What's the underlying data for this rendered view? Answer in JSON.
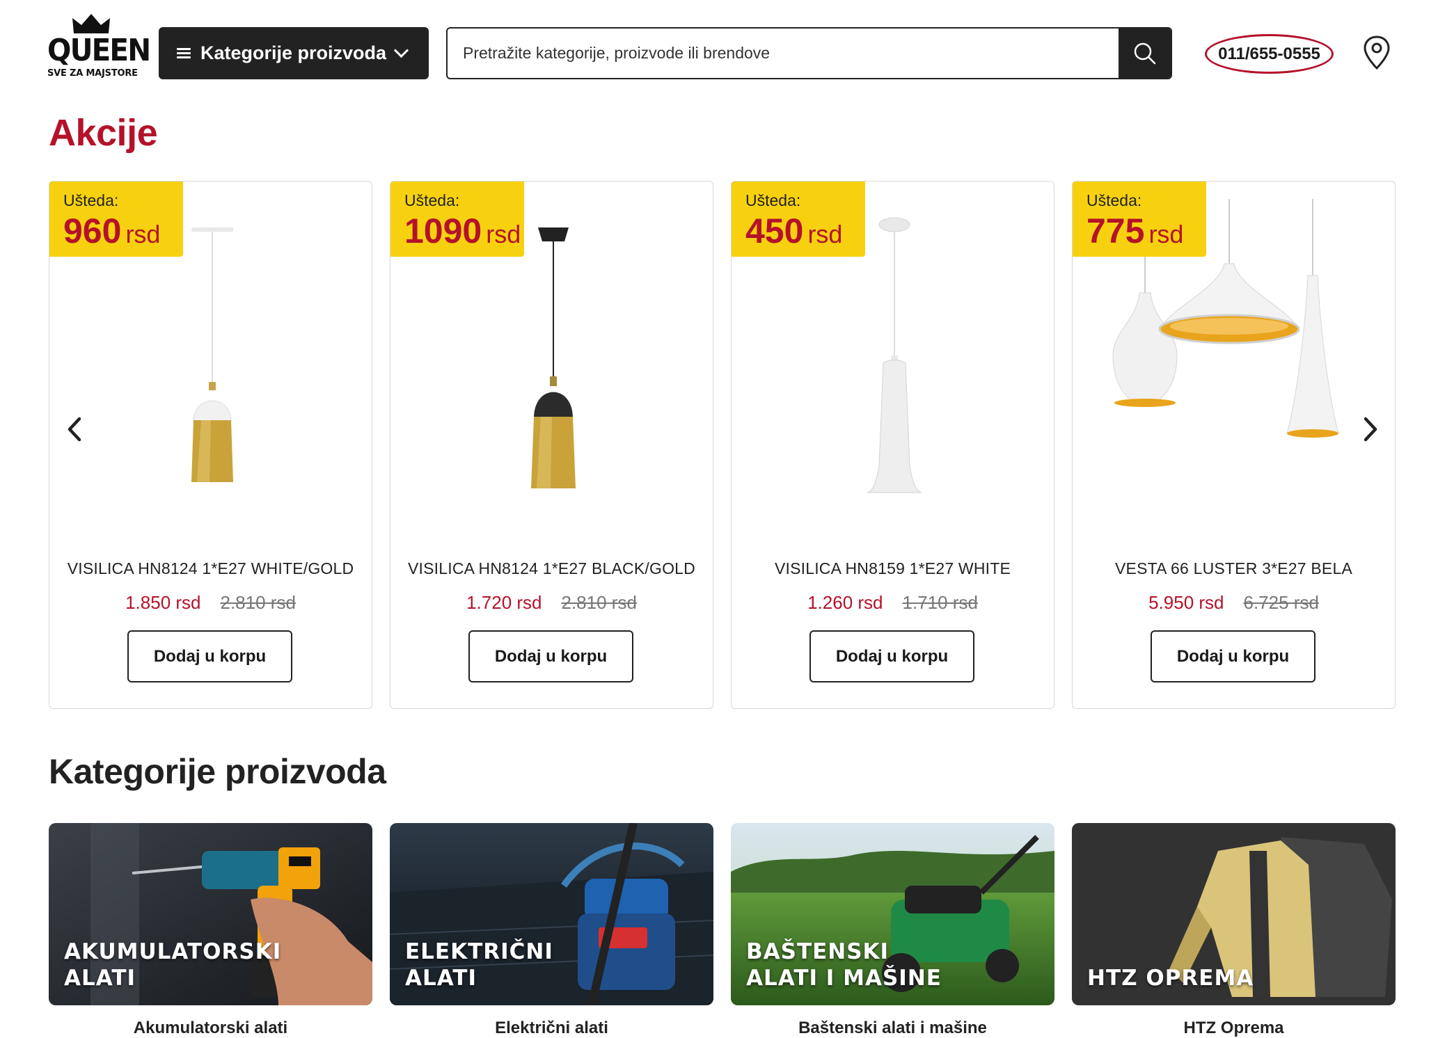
{
  "header": {
    "logo": {
      "brand": "QUEEN",
      "tagline": "SVE ZA MAJSTORE"
    },
    "categories_button": "Kategorije proizvoda",
    "search": {
      "placeholder": "Pretražite kategorije, proizvode ili brendove",
      "value": ""
    },
    "phone": "011/655-0555",
    "icons": {
      "menu": "hamburger-icon",
      "dropdown": "chevron-down-icon",
      "search": "search-icon",
      "location": "location-pin-icon"
    }
  },
  "deals": {
    "title": "Akcije",
    "savings_label": "Ušteda:",
    "currency": "rsd",
    "add_to_cart_label": "Dodaj u korpu",
    "products": [
      {
        "name": "VISILICA HN8124 1*E27 WHITE/GOLD",
        "savings": "960",
        "price": "1.850 rsd",
        "old_price": "2.810 rsd"
      },
      {
        "name": "VISILICA HN8124 1*E27 BLACK/GOLD",
        "savings": "1090",
        "price": "1.720 rsd",
        "old_price": "2.810 rsd"
      },
      {
        "name": "VISILICA HN8159 1*E27 WHITE",
        "savings": "450",
        "price": "1.260 rsd",
        "old_price": "1.710 rsd"
      },
      {
        "name": "VESTA 66 LUSTER 3*E27 BELA",
        "savings": "775",
        "price": "5.950 rsd",
        "old_price": "6.725 rsd"
      }
    ],
    "prev_icon": "chevron-left-icon",
    "next_icon": "chevron-right-icon"
  },
  "categories": {
    "title": "Kategorije proizvoda",
    "items": [
      {
        "overlay": "AKUMULATORSKI\nALATI",
        "caption": "Akumulatorski alati"
      },
      {
        "overlay": "ELEKTRIČNI\nALATI",
        "caption": "Električni alati"
      },
      {
        "overlay": "BAŠTENSKI\nALATI I MAŠINE",
        "caption": "Baštenski alati i mašine"
      },
      {
        "overlay": "HTZ OPREMA",
        "caption": "HTZ Oprema"
      }
    ]
  },
  "colors": {
    "accent_red": "#b5122a",
    "badge_yellow": "#f7d10f",
    "dark": "#222222"
  }
}
